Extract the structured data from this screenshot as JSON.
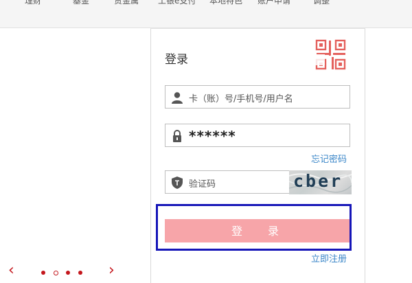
{
  "nav": {
    "items": [
      "理财",
      "基金",
      "贵金属",
      "工银e支付",
      "本地特色",
      "账户申请",
      "调整"
    ]
  },
  "login": {
    "title": "登录",
    "username_placeholder": "卡（账）号/手机号/用户名",
    "password_mask": "******",
    "forgot_label": "忘记密码",
    "captcha_placeholder": "验证码",
    "captcha_text": "cber",
    "submit_label": "登 录",
    "register_label": "立即注册"
  },
  "carousel": {
    "prev_glyph": "‹",
    "next_glyph": "›"
  },
  "colors": {
    "brand_red": "#c4161c",
    "login_button": "#f7a5a9",
    "link_blue": "#3a86c8",
    "highlight_blue": "#1515b8"
  }
}
